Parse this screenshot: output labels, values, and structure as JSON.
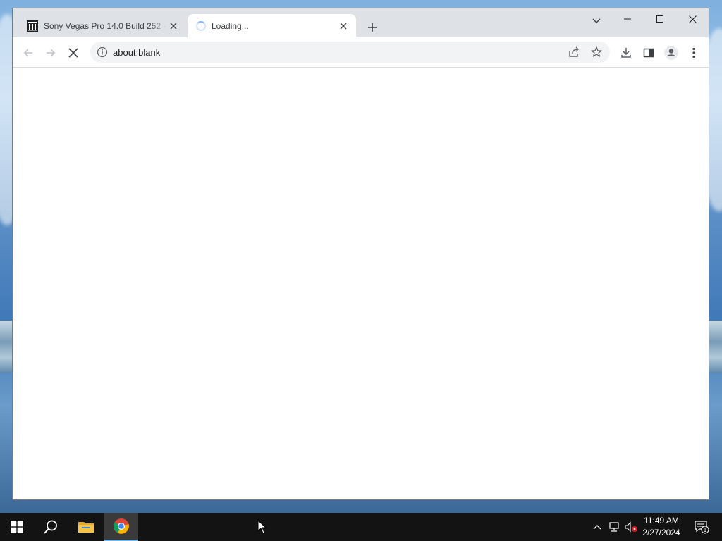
{
  "browser": {
    "tabs": [
      {
        "title": "Sony Vegas Pro 14.0 Build 252 -",
        "favicon": "archive-building-icon",
        "active": false
      },
      {
        "title": "Loading...",
        "favicon": "loading-spinner-icon",
        "active": true
      }
    ],
    "address": {
      "url": "about:blank",
      "info_icon": "info-icon"
    },
    "toolbar_icons": [
      "back-icon",
      "forward-icon",
      "stop-icon",
      "share-icon",
      "star-icon",
      "download-icon",
      "side-panel-icon",
      "profile-icon",
      "menu-icon"
    ]
  },
  "taskbar": {
    "apps": [
      "start-icon",
      "search-icon",
      "file-explorer-icon",
      "chrome-icon"
    ],
    "clock": {
      "time": "11:49 AM",
      "date": "2/27/2024"
    },
    "notifications": {
      "count": "1"
    }
  },
  "colors": {
    "tabstrip": "#dee1e6",
    "omnibox": "#f1f3f4",
    "taskbar": "#131313",
    "accent": "#76b9ed"
  }
}
